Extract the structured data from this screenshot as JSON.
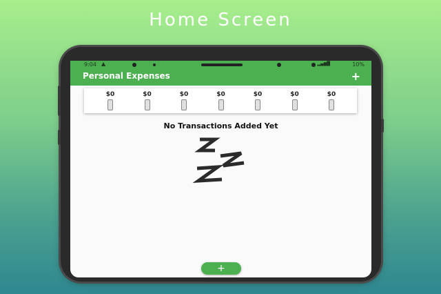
{
  "banner": {
    "title": "Home Screen"
  },
  "status_bar": {
    "time": "9:04",
    "battery": "10%"
  },
  "app_bar": {
    "title": "Personal Expenses",
    "add_label": "+"
  },
  "chart": {
    "items": [
      {
        "amount": "$0",
        "fill": 0
      },
      {
        "amount": "$0",
        "fill": 0
      },
      {
        "amount": "$0",
        "fill": 0
      },
      {
        "amount": "$0",
        "fill": 0
      },
      {
        "amount": "$0",
        "fill": 0
      },
      {
        "amount": "$0",
        "fill": 0
      },
      {
        "amount": "$0",
        "fill": 0
      }
    ]
  },
  "empty_state": {
    "message": "No Transactions Added Yet"
  },
  "fab": {
    "label": "+"
  },
  "colors": {
    "primary": "#4caf50",
    "background_top": "#a8ee8c",
    "background_bottom": "#2f8790"
  }
}
